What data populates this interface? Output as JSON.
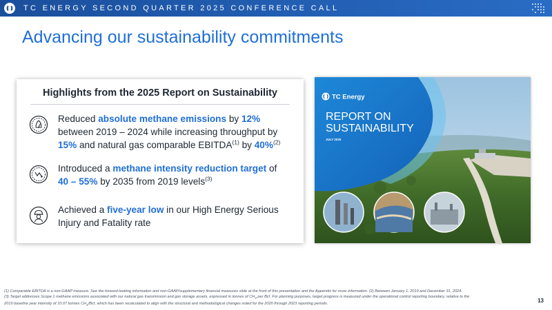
{
  "header": {
    "title": "TC ENERGY SECOND QUARTER 2025 CONFERENCE CALL",
    "logo_icon": "tc-energy-logo-icon",
    "dots_icon": "dot-grid-icon",
    "bar_color": "#1a4f9c"
  },
  "slide": {
    "title": "Advancing our sustainability commitments",
    "title_color": "#1f6fd6"
  },
  "card": {
    "heading": "Highlights from the 2025 Report on Sustainability",
    "highlight_color": "#1f6fd6",
    "items": [
      {
        "icon": "methane-gauge-icon",
        "parts": [
          "Reduced ",
          "absolute methane emissions",
          " by ",
          "12%",
          " between 2019 – 2024 while increasing throughput by ",
          "15%",
          " and natural gas comparable EBITDA",
          "(1)",
          " by ",
          "40%",
          "(2)"
        ]
      },
      {
        "icon": "methane-target-icon",
        "parts": [
          "Introduced a ",
          "methane intensity reduction target",
          " of ",
          "40 – 55%",
          " by 2035 from 2019 levels",
          "(3)"
        ]
      },
      {
        "icon": "hard-hat-worker-icon",
        "parts": [
          "Achieved a ",
          "five-year low",
          " in our High Energy Serious Injury and Fatality rate"
        ]
      }
    ]
  },
  "report_cover": {
    "logo_text": "TC Energy",
    "title_line1": "REPORT ON",
    "title_line2": "SUSTAINABILITY",
    "date": "JULY 2025"
  },
  "footer": {
    "note1": "(1) Comparable EBITDA is a non-GAAP measure. See the forward-looking information and non-GAAP/supplementary financial measures slide at the front of this presentation and the Appendix for more information. (2) Between January 1, 2019 and December 31, 2024.",
    "note2a": "(3) Target addresses Scope 1 methane emissions associated with our natural gas transmission and gas storage assets, expressed in tonnes of CH",
    "note2b": "4",
    "note2c": " per Bcf. For planning purposes, target progress is measured under the operational control reporting boundary, relative to the",
    "note3a": "2019 baseline year intensity of 10.07 tonnes CH",
    "note3b": "4",
    "note3c": "/Bcf, which has been recalculated to align with the structural and methodological changes noted for the 2020 through 2023 reporting periods.",
    "page_number": "13"
  }
}
